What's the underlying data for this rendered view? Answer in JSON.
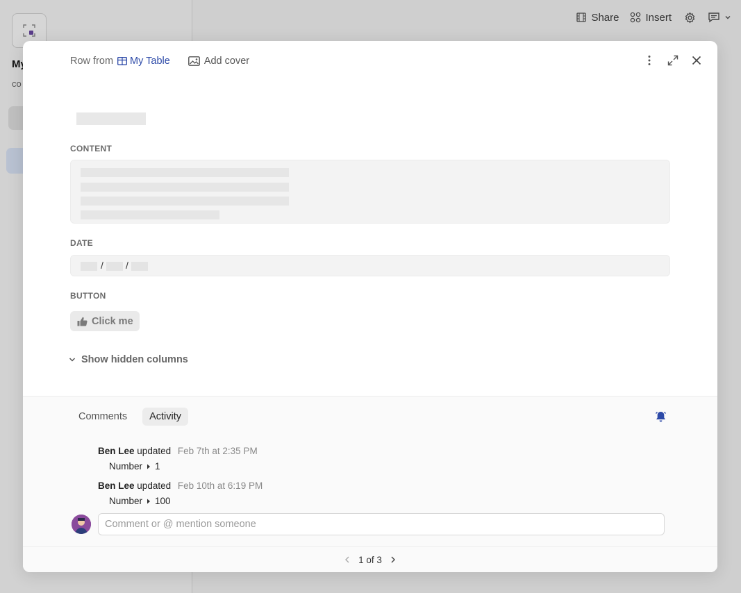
{
  "background": {
    "page_title": "My",
    "page_sub": "co",
    "topbar": {
      "share_label": "Share",
      "insert_label": "Insert"
    }
  },
  "row_modal": {
    "header": {
      "row_from_label": "Row from",
      "table_name": "My Table",
      "add_cover_label": "Add cover"
    },
    "fields": {
      "content_label": "CONTENT",
      "date_label": "DATE",
      "button_label": "BUTTON",
      "button_text": "Click me"
    },
    "show_hidden_columns_label": "Show hidden columns",
    "activity": {
      "tabs": [
        {
          "label": "Comments",
          "active": false
        },
        {
          "label": "Activity",
          "active": true
        }
      ],
      "entries": [
        {
          "user": "Ben Lee",
          "action": "updated",
          "timestamp": "Feb 7th at 2:35 PM",
          "field": "Number",
          "value": "1"
        },
        {
          "user": "Ben Lee",
          "action": "updated",
          "timestamp": "Feb 10th at 6:19 PM",
          "field": "Number",
          "value": "100"
        }
      ],
      "comment_placeholder": "Comment or @ mention someone"
    },
    "pagination": {
      "text": "1 of 3"
    }
  },
  "colors": {
    "accent": "#2d4aa8",
    "bell": "#2d4aa8",
    "avatar": "#8a4a9c"
  },
  "icons": [
    "table-icon",
    "image-icon",
    "more-icon",
    "expand-icon",
    "close-icon",
    "thumbs-up-icon",
    "chevron-down-icon",
    "bell-icon",
    "chevron-left-icon",
    "chevron-right-icon",
    "share-icon",
    "insert-icon",
    "gear-icon",
    "comment-icon"
  ]
}
